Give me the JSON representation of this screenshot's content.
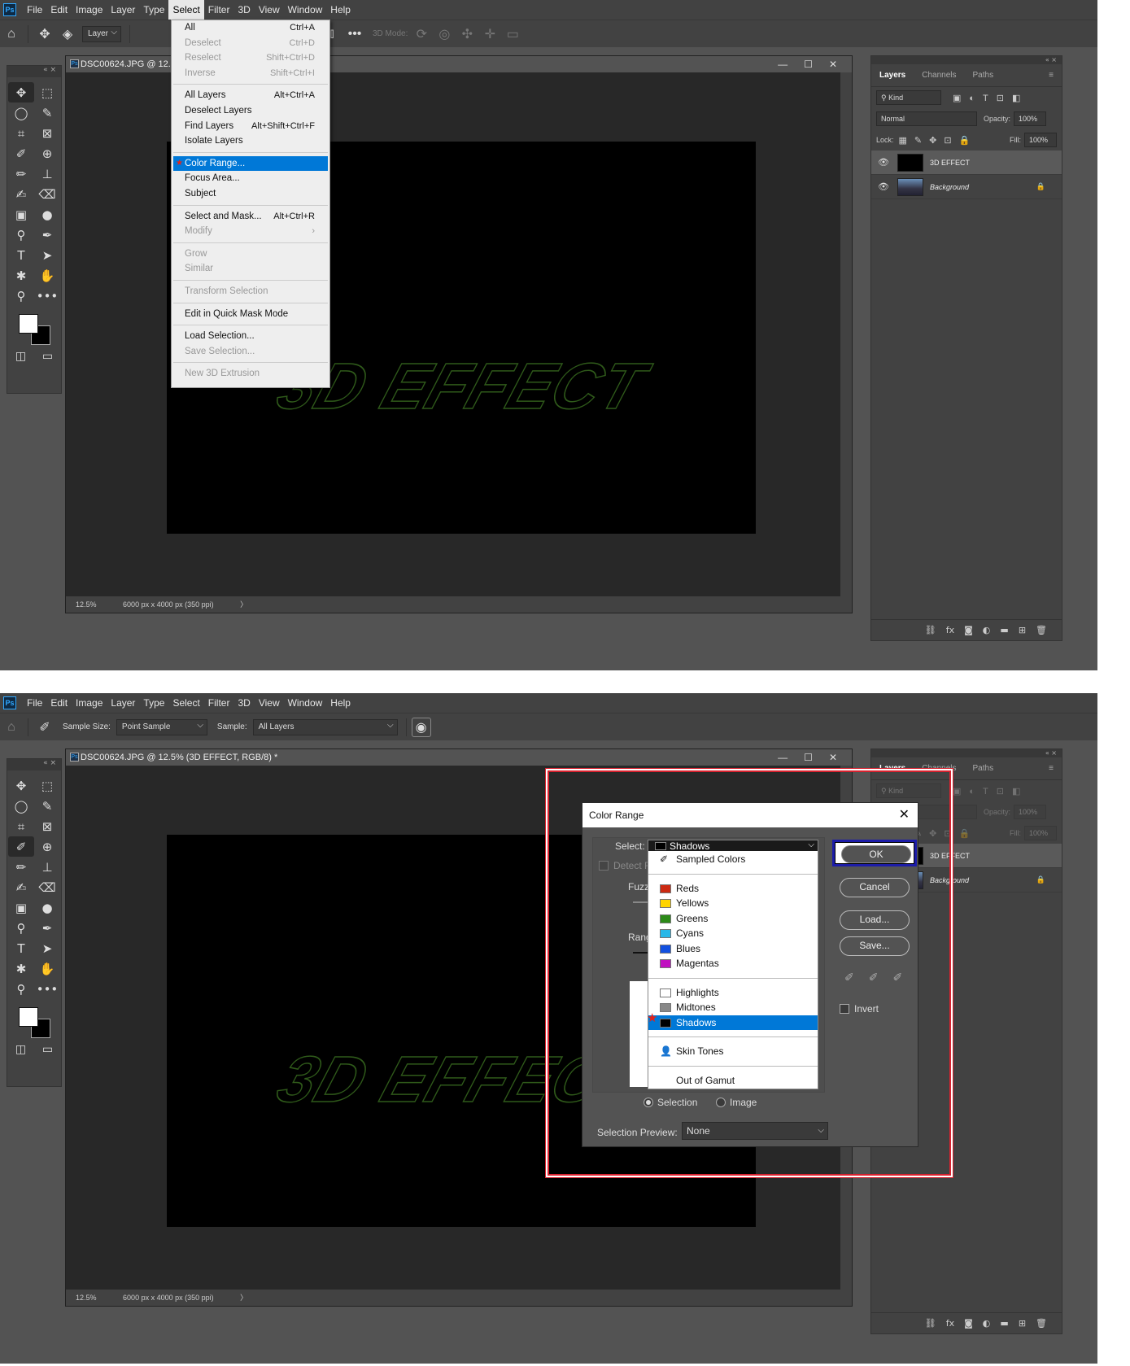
{
  "menubar": [
    "File",
    "Edit",
    "Image",
    "Layer",
    "Type",
    "Select",
    "Filter",
    "3D",
    "View",
    "Window",
    "Help"
  ],
  "app_logo": "Ps",
  "s1": {
    "opt_layer": "Layer",
    "opt_3d": "3D Mode:",
    "doc_title": "DSC00624.JPG @ 12.",
    "zoom": "12.5%",
    "doc_info": "6000 px x 4000 px (350 ppi)",
    "select_menu": [
      {
        "label": "All",
        "sc": "Ctrl+A",
        "dis": false
      },
      {
        "label": "Deselect",
        "sc": "Ctrl+D",
        "dis": true
      },
      {
        "label": "Reselect",
        "sc": "Shift+Ctrl+D",
        "dis": true
      },
      {
        "label": "Inverse",
        "sc": "Shift+Ctrl+I",
        "dis": true
      },
      {
        "sep": true
      },
      {
        "label": "All Layers",
        "sc": "Alt+Ctrl+A",
        "dis": false
      },
      {
        "label": "Deselect Layers",
        "sc": "",
        "dis": false
      },
      {
        "label": "Find Layers",
        "sc": "Alt+Shift+Ctrl+F",
        "dis": false
      },
      {
        "label": "Isolate Layers",
        "sc": "",
        "dis": false
      },
      {
        "sep": true
      },
      {
        "label": "Color Range...",
        "sc": "",
        "dis": false,
        "hl": true
      },
      {
        "label": "Focus Area...",
        "sc": "",
        "dis": false
      },
      {
        "label": "Subject",
        "sc": "",
        "dis": false
      },
      {
        "sep": true
      },
      {
        "label": "Select and Mask...",
        "sc": "Alt+Ctrl+R",
        "dis": false
      },
      {
        "label": "Modify",
        "sc": "›",
        "dis": true
      },
      {
        "sep": true
      },
      {
        "label": "Grow",
        "sc": "",
        "dis": true
      },
      {
        "label": "Similar",
        "sc": "",
        "dis": true
      },
      {
        "sep": true
      },
      {
        "label": "Transform Selection",
        "sc": "",
        "dis": true
      },
      {
        "sep": true
      },
      {
        "label": "Edit in Quick Mask Mode",
        "sc": "",
        "dis": false
      },
      {
        "sep": true
      },
      {
        "label": "Load Selection...",
        "sc": "",
        "dis": false
      },
      {
        "label": "Save Selection...",
        "sc": "",
        "dis": true
      },
      {
        "sep": true
      },
      {
        "label": "New 3D Extrusion",
        "sc": "",
        "dis": true
      }
    ]
  },
  "s2": {
    "sample_size_label": "Sample Size:",
    "sample_size": "Point Sample",
    "sample_label": "Sample:",
    "sample": "All Layers",
    "doc_title": "DSC00624.JPG @ 12.5% (3D EFFECT, RGB/8) *",
    "zoom": "12.5%",
    "doc_info": "6000 px x 4000 px (350 ppi)"
  },
  "canvas_text": "3D EFFECT",
  "panel": {
    "tabs": [
      "Layers",
      "Channels",
      "Paths"
    ],
    "kind": "Kind",
    "blend": "Normal",
    "opacity_label": "Opacity:",
    "opacity": "100%",
    "lock_label": "Lock:",
    "fill_label": "Fill:",
    "fill": "100%",
    "layers": [
      {
        "name": "3D EFFECT",
        "active": true,
        "italic": false
      },
      {
        "name": "Background",
        "active": false,
        "italic": true
      }
    ]
  },
  "dialog": {
    "title": "Color Range",
    "select_label": "Select:",
    "select_value": "Shadows",
    "detect": "Detect F",
    "fuzz": "Fuzzi",
    "range": "Rang",
    "options": [
      {
        "label": "Sampled Colors",
        "color": "",
        "icon": "eyedropper"
      },
      {
        "sep": true
      },
      {
        "label": "Reds",
        "color": "#cc2a12"
      },
      {
        "label": "Yellows",
        "color": "#ffd400"
      },
      {
        "label": "Greens",
        "color": "#2c8a18"
      },
      {
        "label": "Cyans",
        "color": "#28b8e8"
      },
      {
        "label": "Blues",
        "color": "#1250e0"
      },
      {
        "label": "Magentas",
        "color": "#c010c0"
      },
      {
        "sep": true
      },
      {
        "label": "Highlights",
        "color": "#ffffff"
      },
      {
        "label": "Midtones",
        "color": "#888888"
      },
      {
        "label": "Shadows",
        "color": "#000000",
        "hl": true
      },
      {
        "sep": true
      },
      {
        "label": "Skin Tones",
        "color": "",
        "icon": "person"
      },
      {
        "sep": true
      },
      {
        "label": "Out of Gamut",
        "color": ""
      }
    ],
    "ok": "OK",
    "cancel": "Cancel",
    "load": "Load...",
    "save": "Save...",
    "invert": "Invert",
    "radio_selection": "Selection",
    "radio_image": "Image",
    "preview_label": "Selection Preview:",
    "preview_value": "None"
  }
}
